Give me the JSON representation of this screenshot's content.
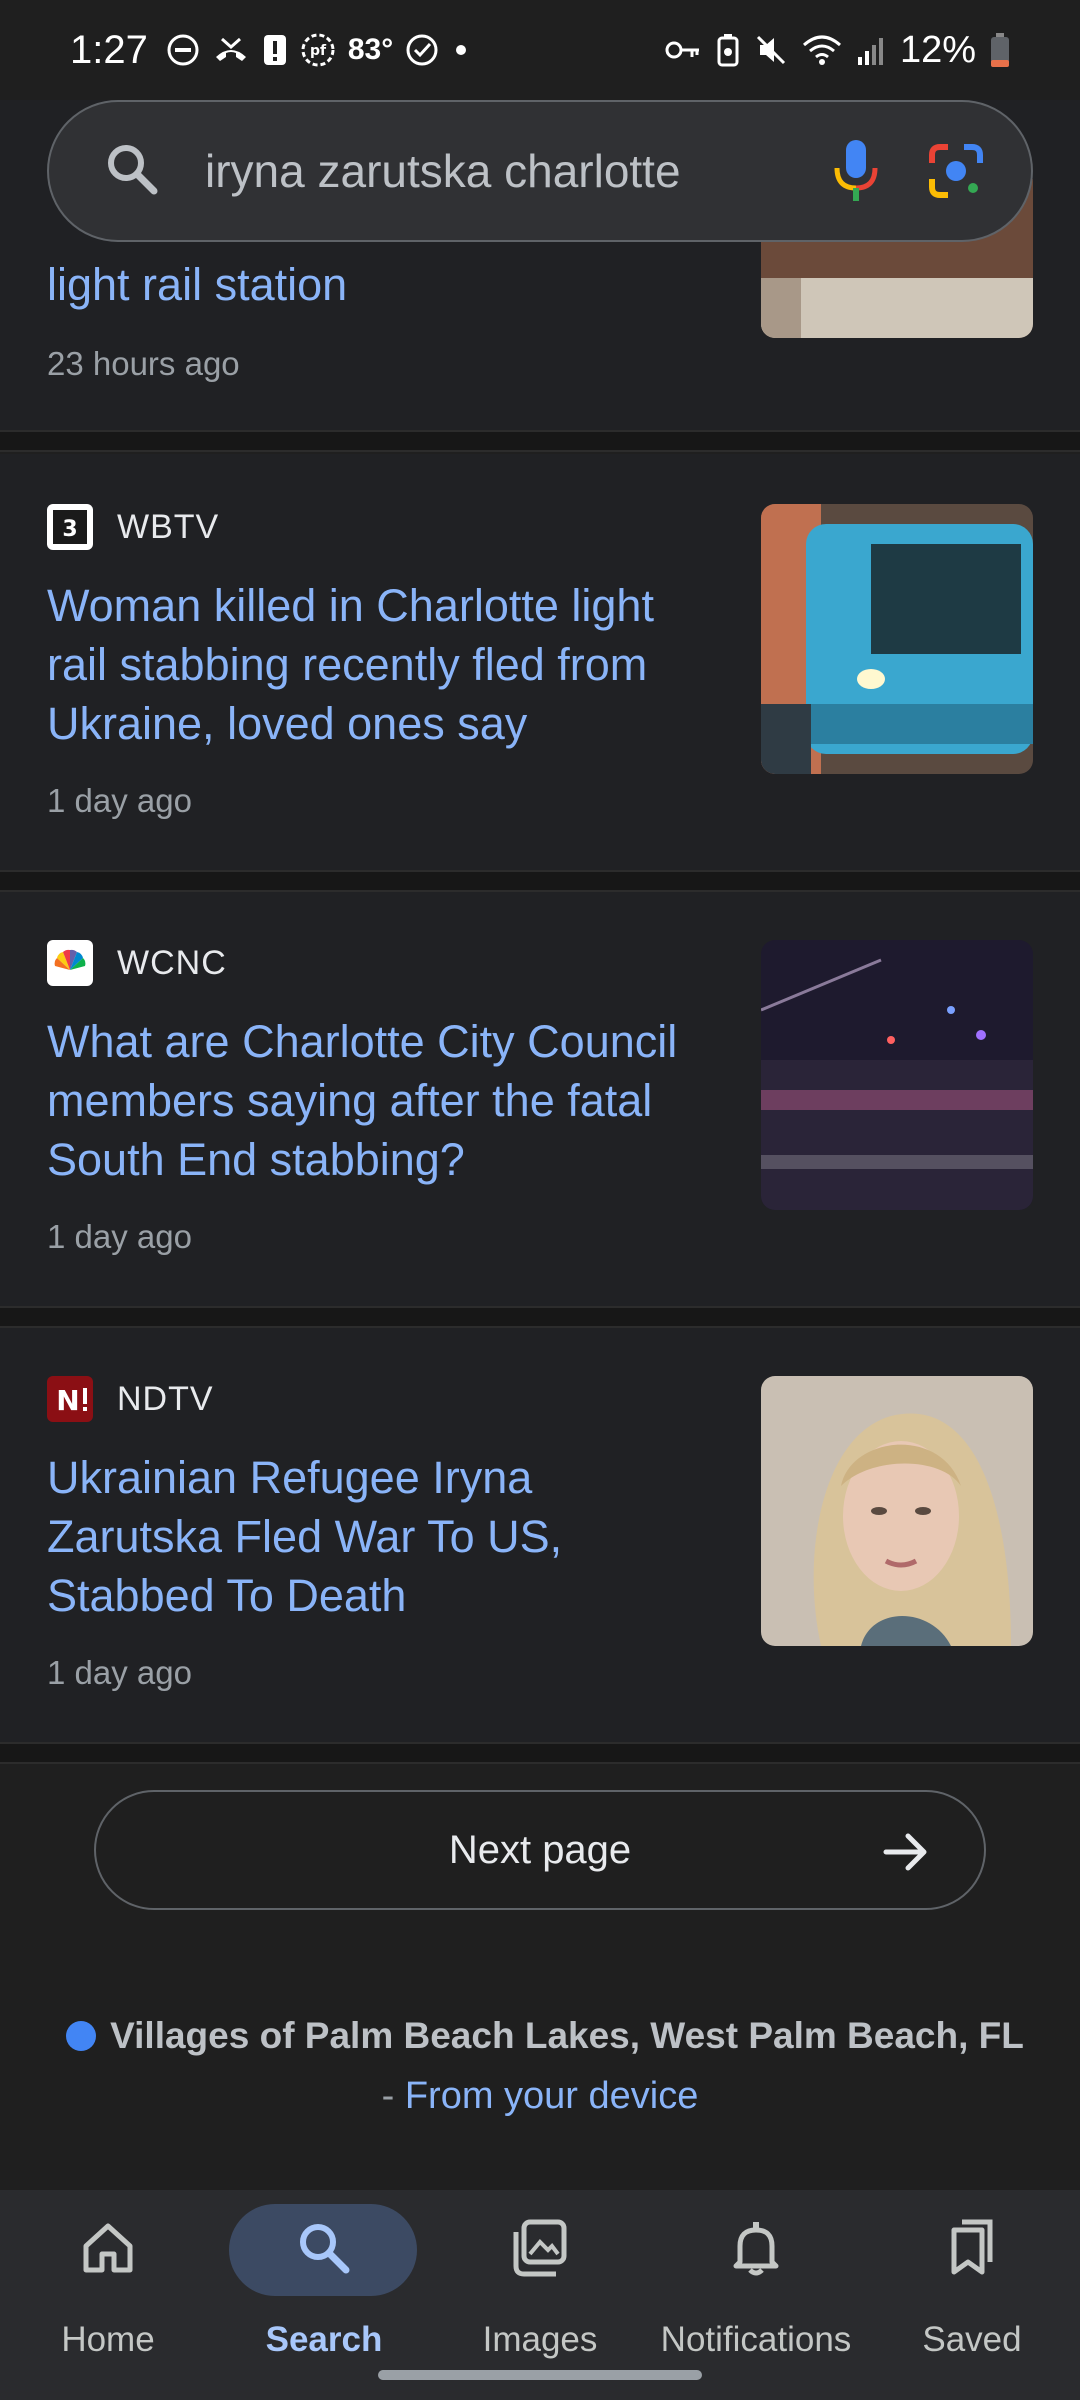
{
  "status_bar": {
    "time": "1:27",
    "temperature": "83°",
    "battery": "12%"
  },
  "search": {
    "query": "iryna zarutska charlotte"
  },
  "results": [
    {
      "title": "light rail station",
      "time": "23 hours ago"
    },
    {
      "source": "WBTV",
      "title": "Woman killed in Charlotte light rail stabbing recently fled from Ukraine, loved ones say",
      "time": "1 day ago"
    },
    {
      "source": "WCNC",
      "title": "What are Charlotte City Council members saying after the fatal South End stabbing?",
      "time": "1 day ago"
    },
    {
      "source": "NDTV",
      "title": "Ukrainian Refugee Iryna Zarutska Fled War To US, Stabbed To Death",
      "time": "1 day ago"
    }
  ],
  "next_page": {
    "label": "Next page"
  },
  "location": {
    "place": "Villages of Palm Beach Lakes, West Palm Beach, FL",
    "prefix": "- ",
    "link": "From your device"
  },
  "bottom_nav": {
    "items": [
      {
        "label": "Home",
        "icon": "home-icon"
      },
      {
        "label": "Search",
        "icon": "search-icon",
        "active": true
      },
      {
        "label": "Images",
        "icon": "images-icon"
      },
      {
        "label": "Notifications",
        "icon": "bell-icon"
      },
      {
        "label": "Saved",
        "icon": "bookmarks-icon"
      }
    ]
  },
  "colors": {
    "background": "#1f1f1f",
    "link": "#8ab4f8",
    "active_pill": "#3c4a63"
  }
}
